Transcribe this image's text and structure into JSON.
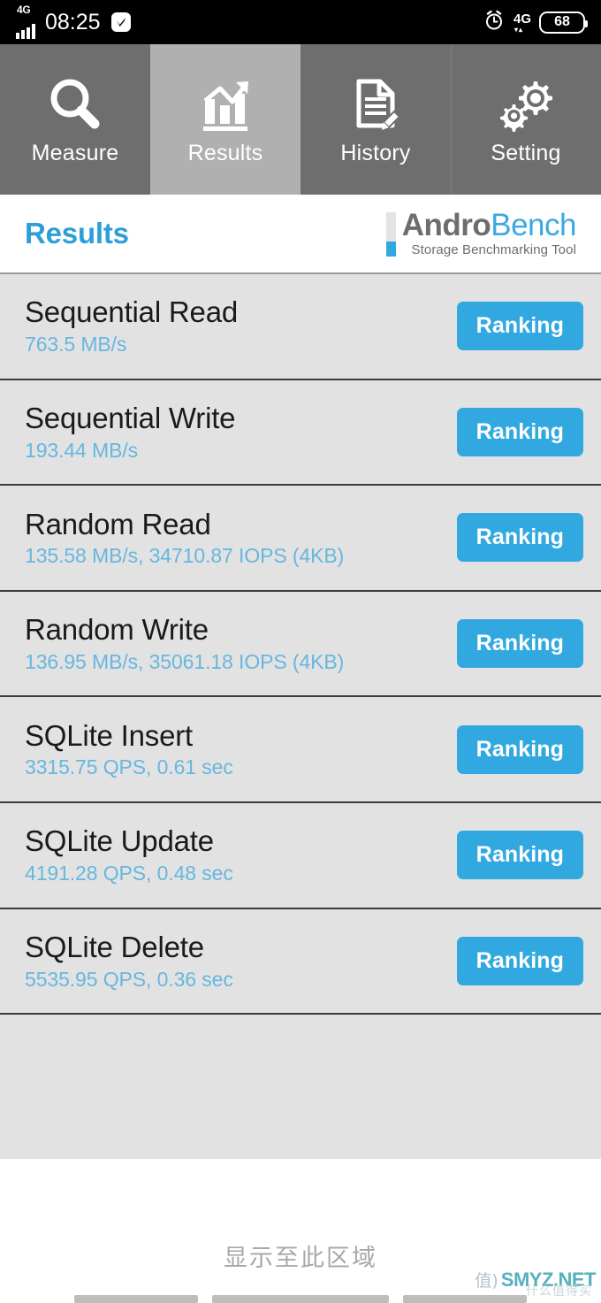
{
  "statusbar": {
    "network_left": "4G",
    "time": "08:25",
    "app_badge_icon": "checkmark-badge-icon",
    "alarm_icon": "alarm-clock-icon",
    "network_right": "4G",
    "data_arrows": "▾▴",
    "battery_level": "68"
  },
  "tabs": [
    {
      "label": "Measure",
      "icon": "magnifier-icon",
      "selected": false
    },
    {
      "label": "Results",
      "icon": "bar-chart-trend-icon",
      "selected": true
    },
    {
      "label": "History",
      "icon": "document-pencil-icon",
      "selected": false
    },
    {
      "label": "Setting",
      "icon": "gears-icon",
      "selected": false
    }
  ],
  "header": {
    "title": "Results",
    "brand_part1": "Andro",
    "brand_part2": "Bench",
    "brand_subtitle": "Storage Benchmarking Tool"
  },
  "results": [
    {
      "title": "Sequential Read",
      "value": "763.5 MB/s",
      "button": "Ranking"
    },
    {
      "title": "Sequential Write",
      "value": "193.44 MB/s",
      "button": "Ranking"
    },
    {
      "title": "Random Read",
      "value": "135.58 MB/s, 34710.87 IOPS (4KB)",
      "button": "Ranking"
    },
    {
      "title": "Random Write",
      "value": "136.95 MB/s, 35061.18 IOPS (4KB)",
      "button": "Ranking"
    },
    {
      "title": "SQLite Insert",
      "value": "3315.75 QPS, 0.61 sec",
      "button": "Ranking"
    },
    {
      "title": "SQLite Update",
      "value": "4191.28 QPS, 0.48 sec",
      "button": "Ranking"
    },
    {
      "title": "SQLite Delete",
      "value": "5535.95 QPS, 0.36 sec",
      "button": "Ranking"
    }
  ],
  "bottom": {
    "hint": "显示至此区域",
    "watermark_badge": "值)",
    "watermark_text": "SMYZ.NET",
    "watermark_sub": "什么值得买"
  },
  "colors": {
    "accent_blue": "#31a9e0",
    "value_blue": "#67b7df",
    "title_blue": "#2c9fd9",
    "tab_bg": "#6e6e6e",
    "tab_selected_bg": "#b0b0b0",
    "list_bg": "#e2e2e2",
    "row_divider": "#3c3c3c"
  }
}
